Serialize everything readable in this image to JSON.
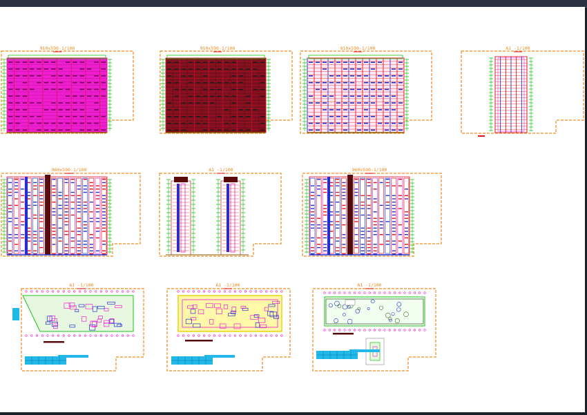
{
  "viewport": {
    "background": "#ffffff",
    "frame_color": "#3a4150"
  },
  "colors": {
    "sheet_border": "#f08a1c",
    "pink": "#ee1fd0",
    "red": "#e01020",
    "blue": "#2030d0",
    "green": "#19c419",
    "cyan": "#22b8e8",
    "dark": "#5a0a0a",
    "yellow": "#e6d200"
  },
  "sheets": [
    {
      "id": "elev-1",
      "label": "910x590-1/100",
      "kind": "elevation",
      "fill": "pink"
    },
    {
      "id": "elev-2",
      "label": "910x590-1/100",
      "kind": "elevation",
      "fill": "dark"
    },
    {
      "id": "elev-3",
      "label": "910x590-1/100",
      "kind": "elevation",
      "fill": "light"
    },
    {
      "id": "elev-4",
      "label": "A1 -1/100",
      "kind": "side-elevation",
      "fill": "side"
    },
    {
      "id": "sect-1",
      "label": "960x590-1/100",
      "kind": "section",
      "fill": "section"
    },
    {
      "id": "sect-2",
      "label": "A1 -1/100",
      "kind": "narrow-sections",
      "fill": "narrow"
    },
    {
      "id": "sect-3",
      "label": "960x590-1/100",
      "kind": "section",
      "fill": "section"
    },
    {
      "id": "plan-1",
      "label": "A1 -1/100",
      "kind": "floor-plan",
      "fill": "plan-pink"
    },
    {
      "id": "plan-2",
      "label": "A1 -1/100",
      "kind": "floor-plan",
      "fill": "plan-yellow"
    },
    {
      "id": "plan-3",
      "label": "A1 -1/100",
      "kind": "site-plan",
      "fill": "plan-site"
    }
  ]
}
